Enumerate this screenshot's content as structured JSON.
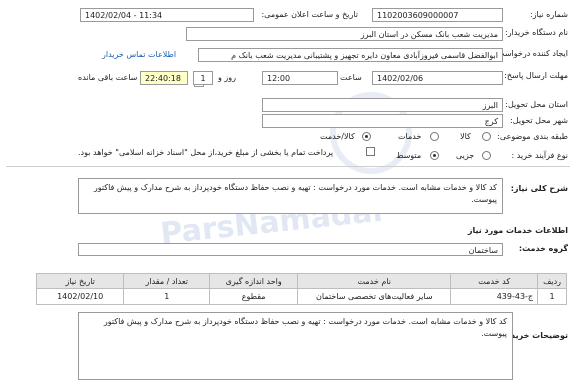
{
  "form": {
    "need_number_label": "شماره نیاز:",
    "need_number": "1102003609000007",
    "announce_label": "تاریخ و ساعت اعلان عمومی:",
    "announce_value": "1402/02/04 - 11:34",
    "buyer_label": "نام دستگاه خریدار:",
    "buyer_value": "مدیریت شعب بانک مسکن در استان البرز",
    "creator_label": "ایجاد کننده درخواست:",
    "creator_value": "ابوالفضل قاسمی فیروزآبادی معاون دایره تجهیز و پشتیبانی مدیریت شعب بانک م",
    "contact_link": "اطلاعات تماس خریدار",
    "deadline_label": "مهلت ارسال پاسخ: تا تاریخ:",
    "deadline_date": "1402/02/06",
    "hour_label": "ساعت",
    "deadline_time": "12:00",
    "days_value": "1",
    "days_label": "روز و",
    "remaining_time": "22:40:18",
    "remaining_label": "ساعت باقی مانده",
    "province_label": "استان محل تحویل:",
    "province_value": "البرز",
    "city_label": "شهر محل تحویل:",
    "city_value": "کرج",
    "category_label": "طبقه بندی موضوعی:",
    "category_options": [
      "کالا",
      "خدمات",
      "کالا/خدمت"
    ],
    "category_selected": 2,
    "payment_label": "نوع فرآیند خرید :",
    "payment_options": [
      "جزیی",
      "متوسط"
    ],
    "payment_selected": 1,
    "payment_note": "پرداخت تمام یا بخشی از مبلغ خرید،از محل \"اسناد خزانه اسلامی\" خواهد بود.",
    "summary_label": "شرح کلی نیاز:",
    "summary_text": "کد کالا و خدمات مشابه است. خدمات مورد درخواست : تهیه و نصب حفاظ دستگاه خودپرداز به شرح مدارک و پیش فاکتور پیوست."
  },
  "services": {
    "section_title": "اطلاعات خدمات مورد نیاز",
    "group_label": "گروه خدمت:",
    "group_value": "ساختمان",
    "columns": [
      "ردیف",
      "کد خدمت",
      "نام خدمت",
      "واحد اندازه گیری",
      "تعداد / مقدار",
      "تاریخ نیاز"
    ],
    "rows": [
      [
        "1",
        "ج-43-439",
        "سایر فعالیت‌های تخصصی ساختمان",
        "مقطوع",
        "1",
        "1402/02/10"
      ]
    ]
  },
  "buyer_notes": {
    "label": "توضیحات خریدار:",
    "text": "کد کالا و خدمات مشابه است. خدمات مورد درخواست : تهیه و نصب حفاظ دستگاه خودپرداز به شرح مدارک و پیش فاکتور پیوست."
  }
}
